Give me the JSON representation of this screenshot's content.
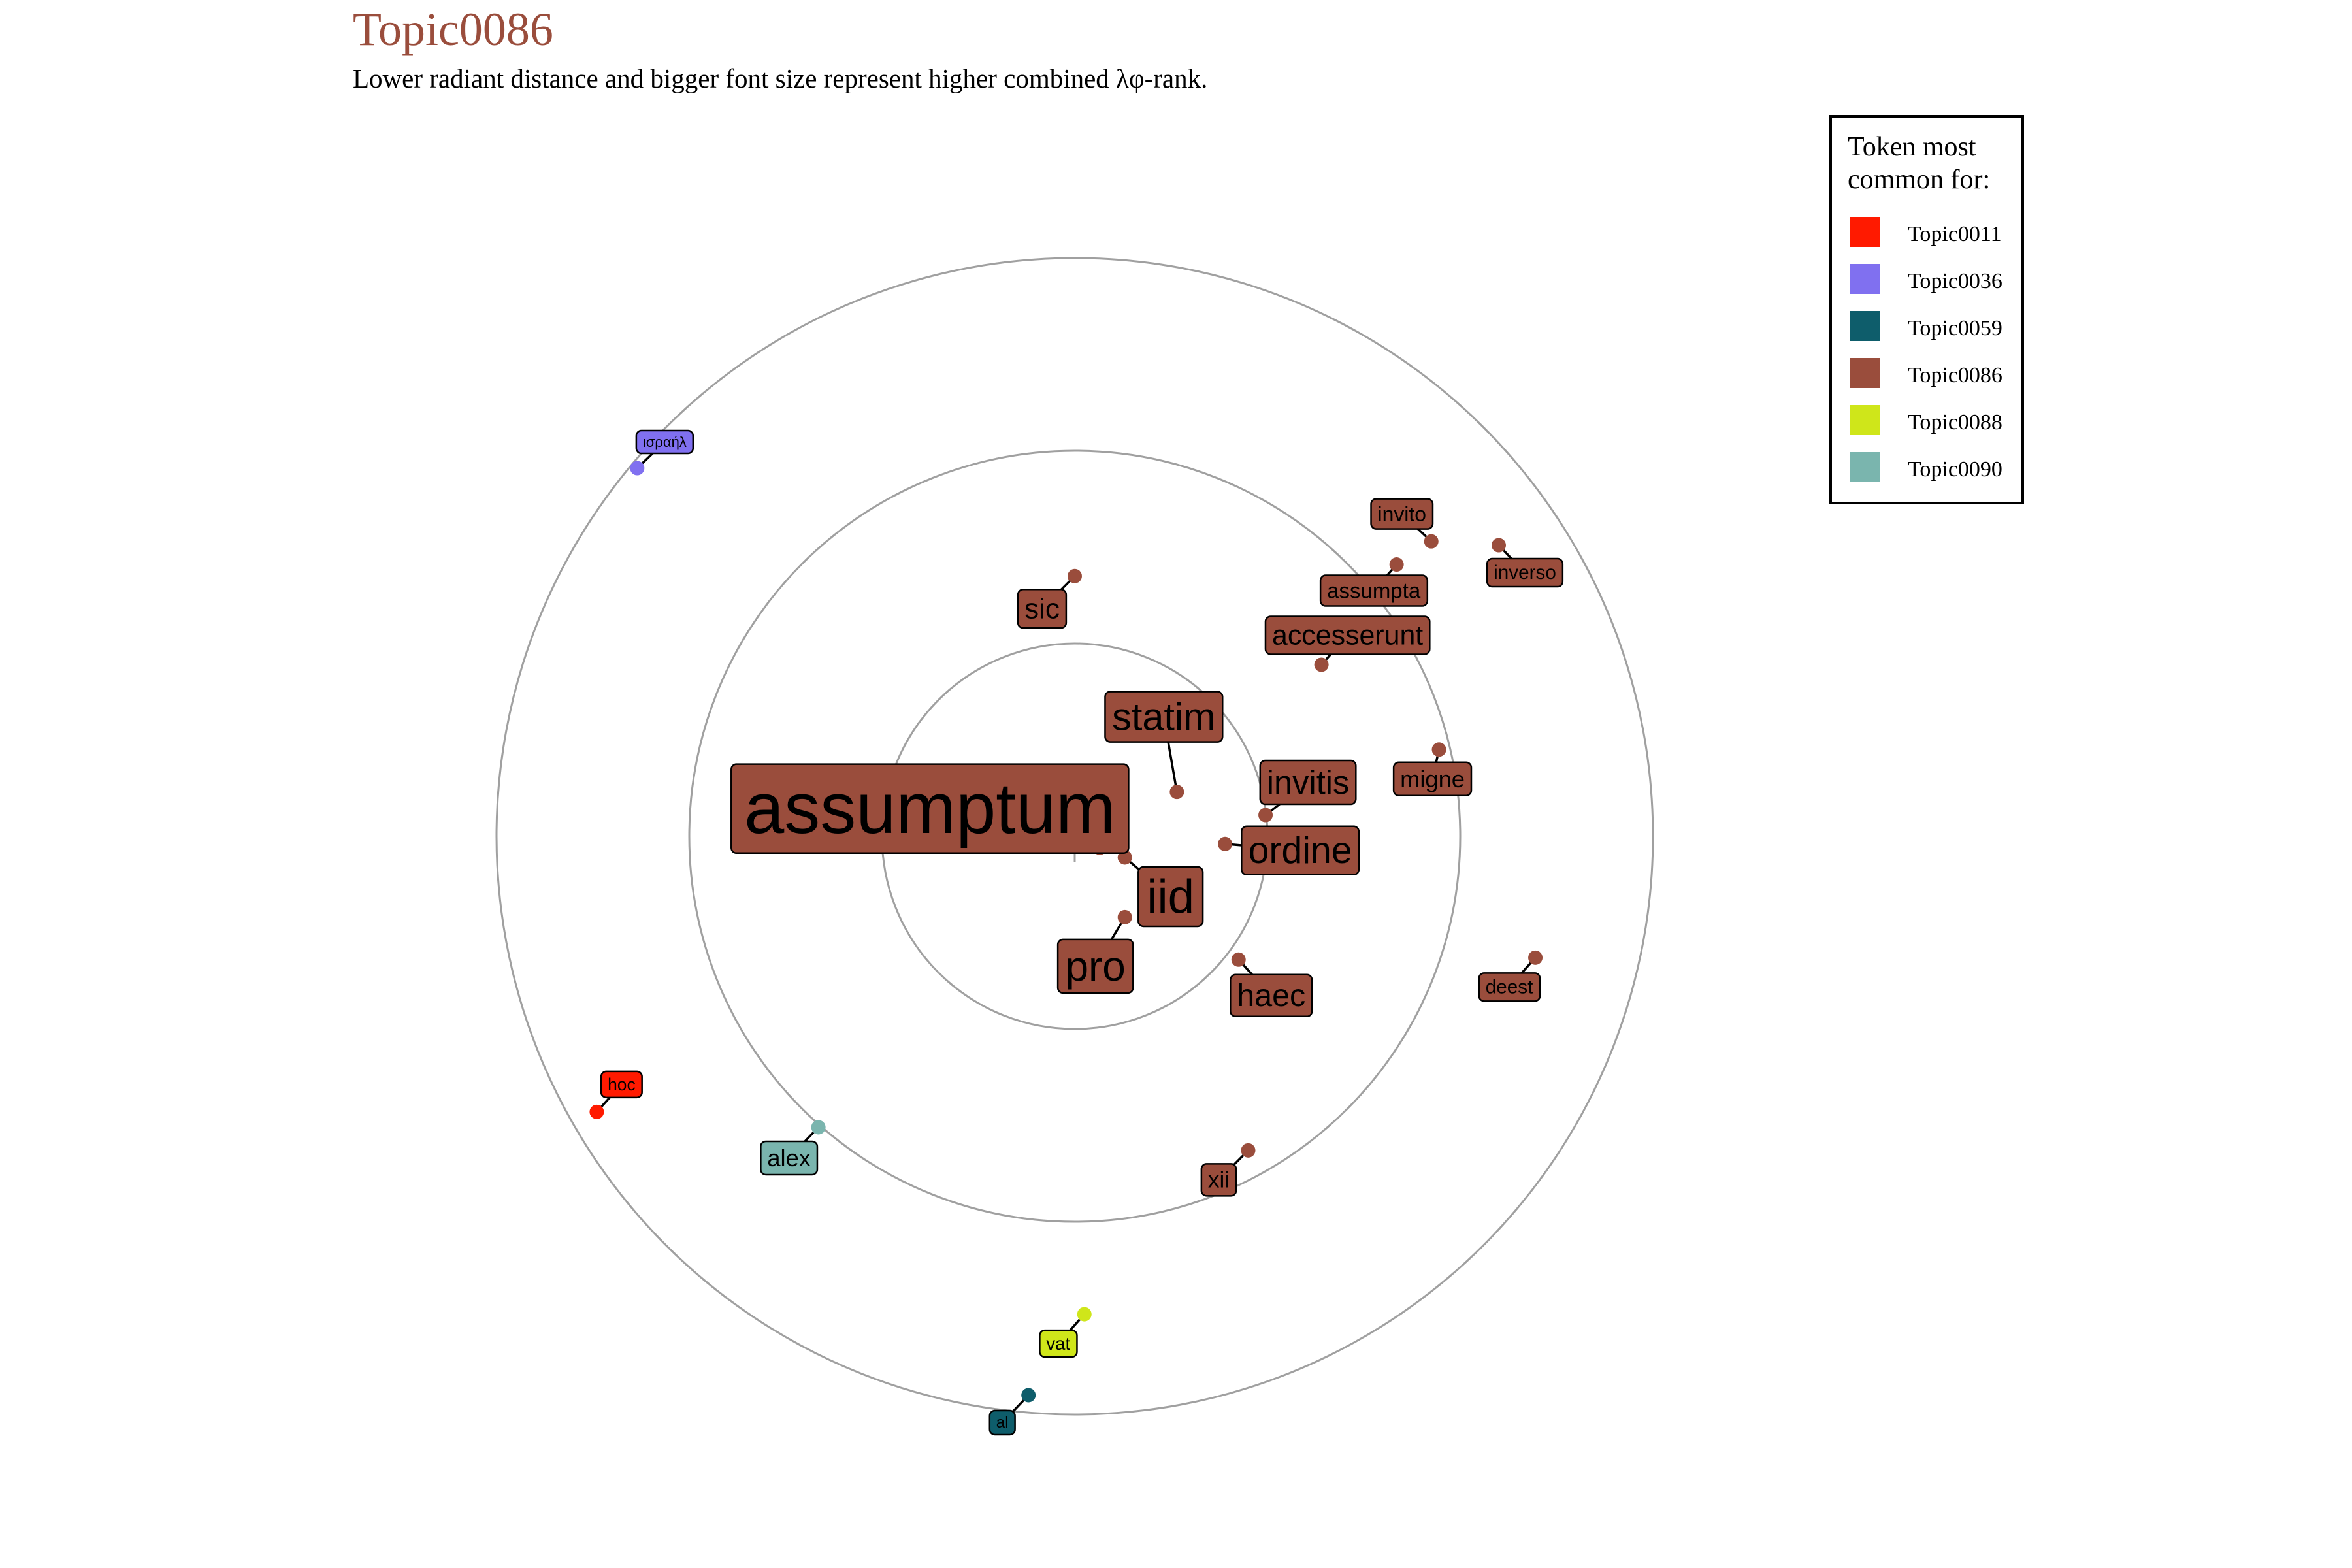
{
  "chart_data": {
    "type": "scatter",
    "title": "Topic0086",
    "subtitle": "Lower radiant distance and bigger font size represent higher combined λφ-rank.",
    "legend": {
      "title": "Token most common for:",
      "placement": "right",
      "items": [
        {
          "name": "Topic0011",
          "color": "#ff1a00"
        },
        {
          "name": "Topic0036",
          "color": "#8070f0"
        },
        {
          "name": "Topic0059",
          "color": "#0e5d6b"
        },
        {
          "name": "Topic0086",
          "color": "#9a4d3c"
        },
        {
          "name": "Topic0088",
          "color": "#cfe61a"
        },
        {
          "name": "Topic0090",
          "color": "#7ab5ae"
        }
      ]
    },
    "rings": [
      1,
      2,
      3
    ],
    "tokens": [
      {
        "label": "assumptum",
        "topic": "Topic0086",
        "x": 0.13,
        "y": -0.06,
        "size": 5.0
      },
      {
        "label": "iid",
        "topic": "Topic0086",
        "x": 0.26,
        "y": -0.11,
        "size": 3.3
      },
      {
        "label": "statim",
        "topic": "Topic0086",
        "x": 0.53,
        "y": 0.23,
        "size": 2.7
      },
      {
        "label": "ordine",
        "topic": "Topic0086",
        "x": 0.78,
        "y": -0.04,
        "size": 2.6
      },
      {
        "label": "pro",
        "topic": "Topic0086",
        "x": 0.26,
        "y": -0.42,
        "size": 2.9
      },
      {
        "label": "invitis",
        "topic": "Topic0086",
        "x": 0.99,
        "y": 0.11,
        "size": 2.3
      },
      {
        "label": "haec",
        "topic": "Topic0086",
        "x": 0.85,
        "y": -0.64,
        "size": 2.2
      },
      {
        "label": "sic",
        "topic": "Topic0086",
        "x": 0.0,
        "y": 1.35,
        "size": 2.0
      },
      {
        "label": "accesserunt",
        "topic": "Topic0086",
        "x": 1.28,
        "y": 0.89,
        "size": 1.95
      },
      {
        "label": "migne",
        "topic": "Topic0086",
        "x": 1.89,
        "y": 0.45,
        "size": 1.65
      },
      {
        "label": "assumpta",
        "topic": "Topic0086",
        "x": 1.67,
        "y": 1.41,
        "size": 1.5
      },
      {
        "label": "invito",
        "topic": "Topic0086",
        "x": 1.85,
        "y": 1.53,
        "size": 1.45
      },
      {
        "label": "inverso",
        "topic": "Topic0086",
        "x": 2.2,
        "y": 1.51,
        "size": 1.35
      },
      {
        "label": "deest",
        "topic": "Topic0086",
        "x": 2.39,
        "y": -0.63,
        "size": 1.35
      },
      {
        "label": "xii",
        "topic": "Topic0086",
        "x": 0.9,
        "y": -1.63,
        "size": 1.6
      },
      {
        "label": "alex",
        "topic": "Topic0090",
        "x": -1.33,
        "y": -1.51,
        "size": 1.65
      },
      {
        "label": "hoc",
        "topic": "Topic0011",
        "x": -2.48,
        "y": -1.43,
        "size": 1.2
      },
      {
        "label": "ισραήλ",
        "topic": "Topic0036",
        "x": -2.27,
        "y": 1.91,
        "size": 1.0
      },
      {
        "label": "vat",
        "topic": "Topic0088",
        "x": 0.05,
        "y": -2.48,
        "size": 1.25
      },
      {
        "label": "al",
        "topic": "Topic0059",
        "x": -0.24,
        "y": -2.9,
        "size": 1.1
      }
    ]
  }
}
